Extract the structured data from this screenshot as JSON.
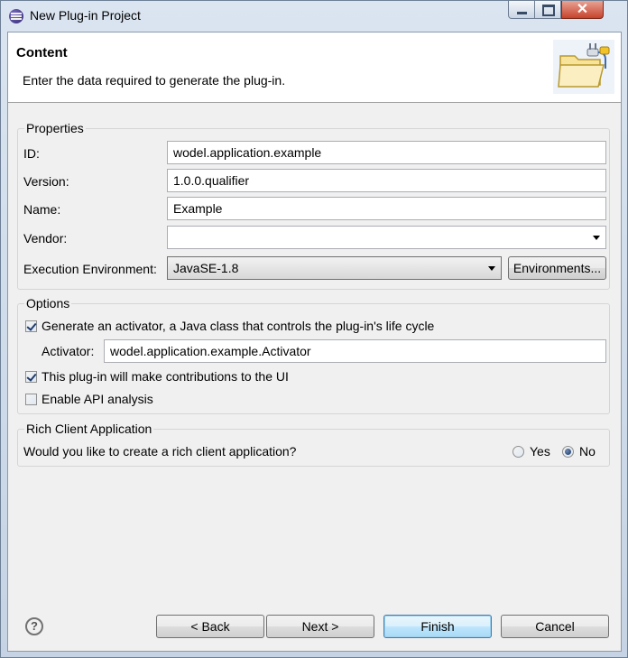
{
  "window": {
    "title": "New Plug-in Project",
    "close_glyph": "✕"
  },
  "banner": {
    "title": "Content",
    "description": "Enter the data required to generate the plug-in.",
    "icon": "folder-plugin-icon"
  },
  "properties": {
    "group_label": "Properties",
    "id": {
      "label": "ID:",
      "value": "wodel.application.example"
    },
    "version": {
      "label": "Version:",
      "value": "1.0.0.qualifier"
    },
    "name": {
      "label": "Name:",
      "value": "Example"
    },
    "vendor": {
      "label": "Vendor:",
      "value": ""
    },
    "execution_env": {
      "label": "Execution Environment:",
      "value": "JavaSE-1.8",
      "button": "Environments..."
    }
  },
  "options": {
    "group_label": "Options",
    "generate_activator": {
      "label": "Generate an activator, a Java class that controls the plug-in's life cycle",
      "checked": true
    },
    "activator": {
      "label": "Activator:",
      "value": "wodel.application.example.Activator"
    },
    "ui_contributions": {
      "label": "This plug-in will make contributions to the UI",
      "checked": true
    },
    "api_analysis": {
      "label": "Enable API analysis",
      "checked": false
    }
  },
  "rcp": {
    "group_label": "Rich Client Application",
    "question": "Would you like to create a rich client application?",
    "yes_label": "Yes",
    "no_label": "No",
    "selected": "No"
  },
  "footer": {
    "help": "?",
    "back": "< Back",
    "next": "Next >",
    "finish": "Finish",
    "cancel": "Cancel"
  }
}
